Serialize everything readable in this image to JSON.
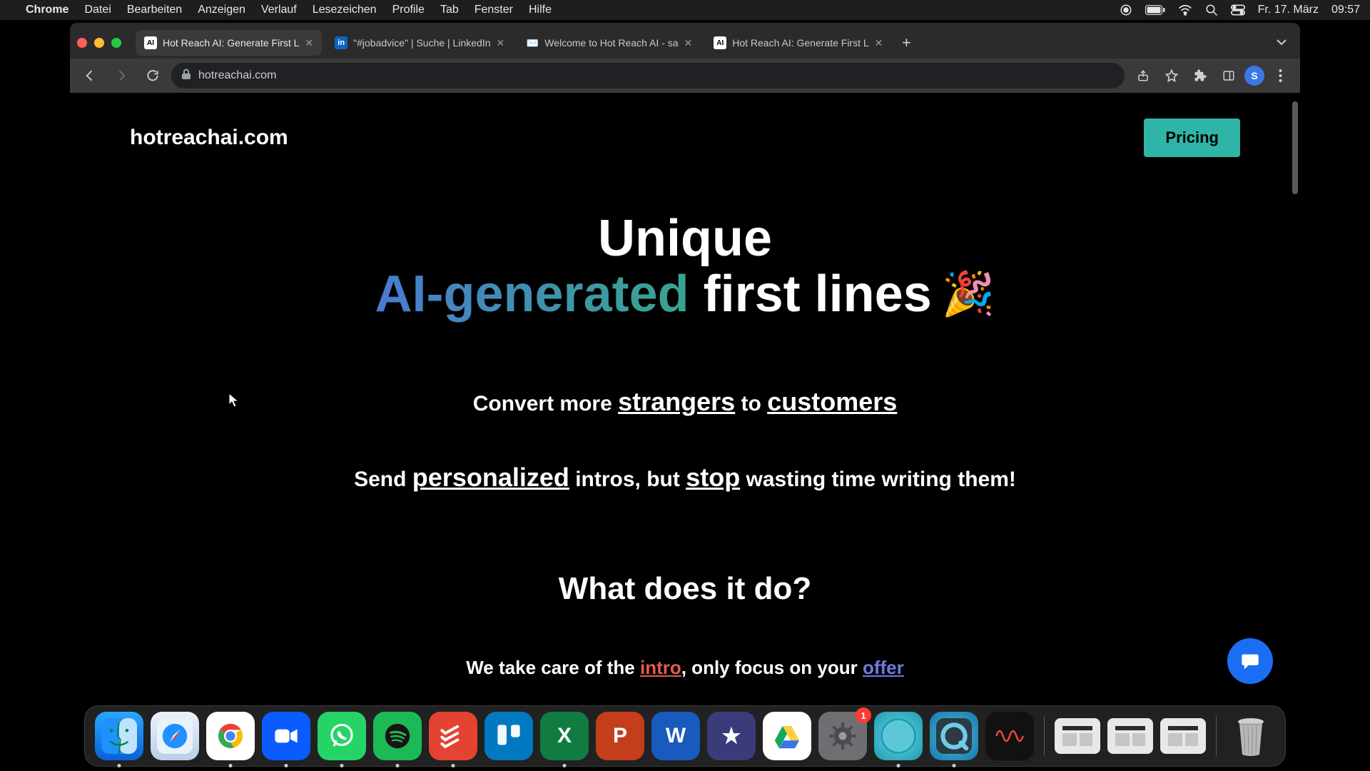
{
  "menubar": {
    "app": "Chrome",
    "items": [
      "Datei",
      "Bearbeiten",
      "Anzeigen",
      "Verlauf",
      "Lesezeichen",
      "Profile",
      "Tab",
      "Fenster",
      "Hilfe"
    ],
    "date": "Fr. 17. März",
    "time": "09:57"
  },
  "tabs": [
    {
      "favicon": "ai",
      "title": "Hot Reach AI: Generate First L",
      "active": true
    },
    {
      "favicon": "li",
      "title": "\"#jobadvice\" | Suche | LinkedIn",
      "active": false
    },
    {
      "favicon": "gm",
      "title": "Welcome to Hot Reach AI - sa",
      "active": false
    },
    {
      "favicon": "ai",
      "title": "Hot Reach AI: Generate First L",
      "active": false
    }
  ],
  "omnibox": {
    "url": "hotreachai.com"
  },
  "profile_initial": "S",
  "site": {
    "brand": "hotreachai.com",
    "pricing": "Pricing",
    "hero": {
      "l1": "Unique",
      "l2": "AI-generated",
      "l3": "first lines",
      "emoji": "🎉"
    },
    "sub1": {
      "a": "Convert more ",
      "b": "strangers",
      "c": " to ",
      "d": "customers"
    },
    "sub2": {
      "a": "Send ",
      "b": "personalized",
      "c": " intros, but ",
      "d": "stop",
      "e": " wasting time writing them!"
    },
    "section_h": "What does it do?",
    "section_p": {
      "a": "We take care of the ",
      "b": "intro",
      "c": ", only focus on your ",
      "d": "offer"
    }
  },
  "dock": {
    "badge": "1",
    "apps": [
      {
        "name": "finder",
        "bg": "linear-gradient(#29a7ff,#0a61d6)",
        "glyph": "",
        "running": true
      },
      {
        "name": "safari",
        "bg": "linear-gradient(#e9f2fb,#b8cfe8)",
        "glyph": "",
        "running": false
      },
      {
        "name": "chrome",
        "bg": "#fff",
        "glyph": "",
        "running": true
      },
      {
        "name": "zoom",
        "bg": "#0b5cff",
        "glyph": "",
        "running": true
      },
      {
        "name": "whatsapp",
        "bg": "#25d366",
        "glyph": "",
        "running": true
      },
      {
        "name": "spotify",
        "bg": "#1db954",
        "glyph": "",
        "running": true
      },
      {
        "name": "todoist",
        "bg": "#e44332",
        "glyph": "",
        "running": true
      },
      {
        "name": "trello",
        "bg": "#0079bf",
        "glyph": "",
        "running": false
      },
      {
        "name": "excel",
        "bg": "#107c41",
        "glyph": "X",
        "running": true
      },
      {
        "name": "powerpoint",
        "bg": "#c43e1c",
        "glyph": "P",
        "running": false
      },
      {
        "name": "word",
        "bg": "#185abd",
        "glyph": "W",
        "running": false
      },
      {
        "name": "imovie",
        "bg": "#3b3b7a",
        "glyph": "★",
        "running": false
      },
      {
        "name": "drive",
        "bg": "#fff",
        "glyph": "",
        "running": false
      },
      {
        "name": "settings",
        "bg": "#6e6e73",
        "glyph": "",
        "running": false,
        "badge": true
      },
      {
        "name": "app-teal",
        "bg": "radial-gradient(circle at 50% 50%, #6dd6e6, #1a9bb0)",
        "glyph": "",
        "running": true
      },
      {
        "name": "quicktime",
        "bg": "radial-gradient(circle at 50% 50%, #4fc0e8, #1676a8)",
        "glyph": "",
        "running": true
      },
      {
        "name": "voice-memos",
        "bg": "#111",
        "glyph": "",
        "running": false
      }
    ]
  }
}
